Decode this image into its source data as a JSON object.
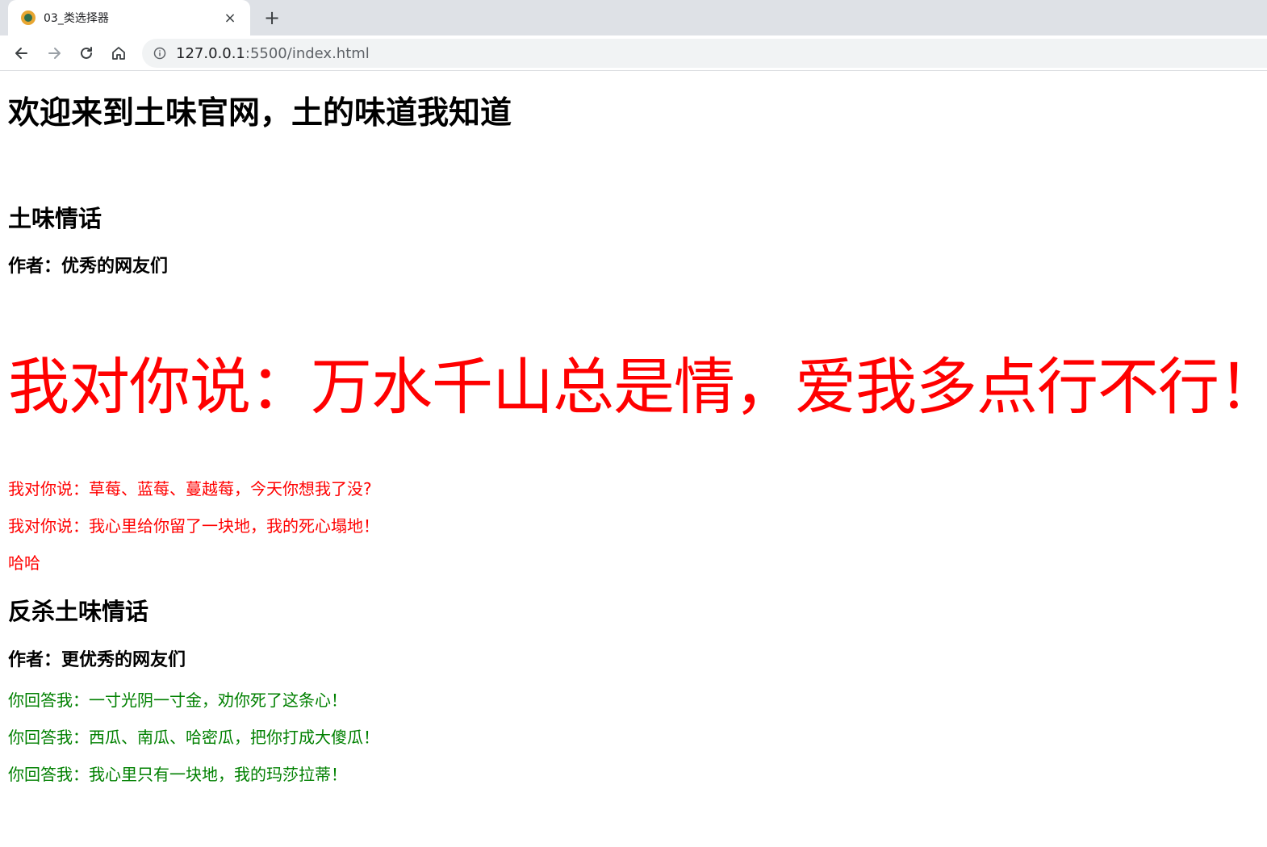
{
  "browser": {
    "tab_title": "03_类选择器",
    "tab_close": "×",
    "new_tab": "+",
    "url_host": "127.0.0.1",
    "url_rest": ":5500/index.html"
  },
  "page": {
    "heading": "欢迎来到土味官网，土的味道我知道",
    "section1": {
      "title": "土味情话",
      "author": "作者：优秀的网友们",
      "big_line": "我对你说：万水千山总是情，爱我多点行不行！",
      "lines": [
        "我对你说：草莓、蓝莓、蔓越莓，今天你想我了没?",
        "我对你说：我心里给你留了一块地，我的死心塌地！",
        "哈哈"
      ]
    },
    "section2": {
      "title": "反杀土味情话",
      "author": "作者：更优秀的网友们",
      "lines": [
        "你回答我：一寸光阴一寸金，劝你死了这条心！",
        "你回答我：西瓜、南瓜、哈密瓜，把你打成大傻瓜！",
        "你回答我：我心里只有一块地，我的玛莎拉蒂！"
      ]
    }
  },
  "colors": {
    "red": "#ff0000",
    "green": "#008000"
  },
  "icons": {
    "back": "back-arrow-icon",
    "forward": "forward-arrow-icon",
    "reload": "reload-icon",
    "home": "home-icon",
    "info": "info-icon",
    "favicon": "favicon-icon"
  }
}
